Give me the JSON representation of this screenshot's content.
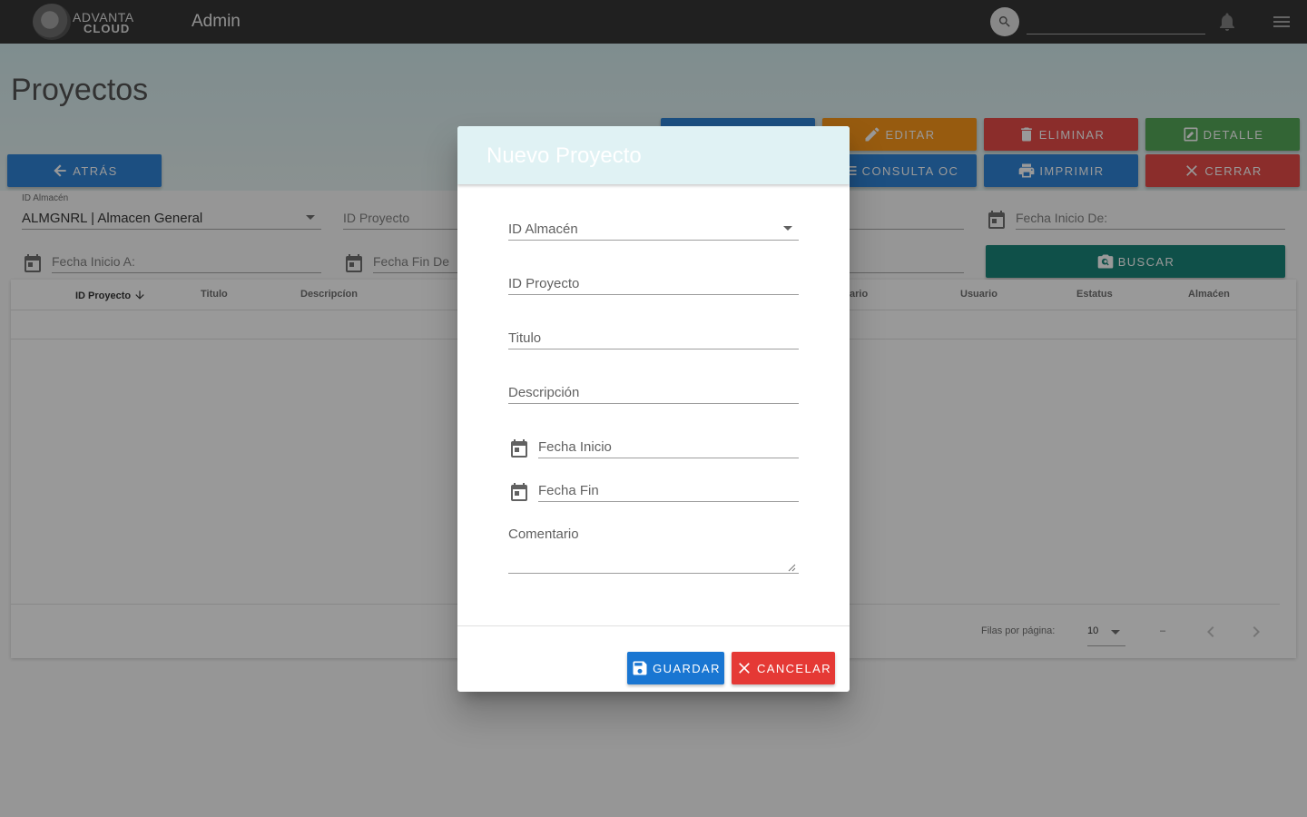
{
  "topbar": {
    "logo_line1": "ADVANTA",
    "logo_line2": "CLOUD",
    "app_title": "Admin",
    "search_placeholder": ""
  },
  "page": {
    "title": "Proyectos"
  },
  "actions": {
    "back": "ATRÁS",
    "edit": "EDITAR",
    "delete": "ELIMINAR",
    "detail": "DETALLE",
    "consulta": "CONSULTA OC",
    "print": "IMPRIMIR",
    "close": "CERRAR",
    "search": "BUSCAR"
  },
  "filters": {
    "almacen_label": "ID Almacén",
    "almacen_value": "ALMGNRL | Almacen General",
    "proyecto_label": "ID Proyecto",
    "fecha_inicio_de": "Fecha Inicio De:",
    "fecha_inicio_a": "Fecha Inicio A:",
    "fecha_fin_de": "Fecha Fin De"
  },
  "table": {
    "headers": [
      "ID Proyecto",
      "Titulo",
      "Descripcíon",
      "ario",
      "Usuario",
      "Estatus",
      "Almaćen"
    ],
    "rows_per_page_label": "Filas por página:",
    "rows_per_page_value": "10",
    "range_text": "–"
  },
  "dialog": {
    "title": "Nuevo Proyecto",
    "almacen_label": "ID Almacén",
    "proyecto_label": "ID Proyecto",
    "titulo_label": "Titulo",
    "descripcion_label": "Descripción",
    "fecha_inicio_label": "Fecha Inicio",
    "fecha_fin_label": "Fecha Fin",
    "comentario_label": "Comentario",
    "save": "GUARDAR",
    "cancel": "CANCELAR"
  },
  "colors": {
    "blue": "#1976d2",
    "orange": "#fb8c00",
    "red": "#e53935",
    "green": "#43a047",
    "teal": "#00796b",
    "topbar": "#212121"
  }
}
